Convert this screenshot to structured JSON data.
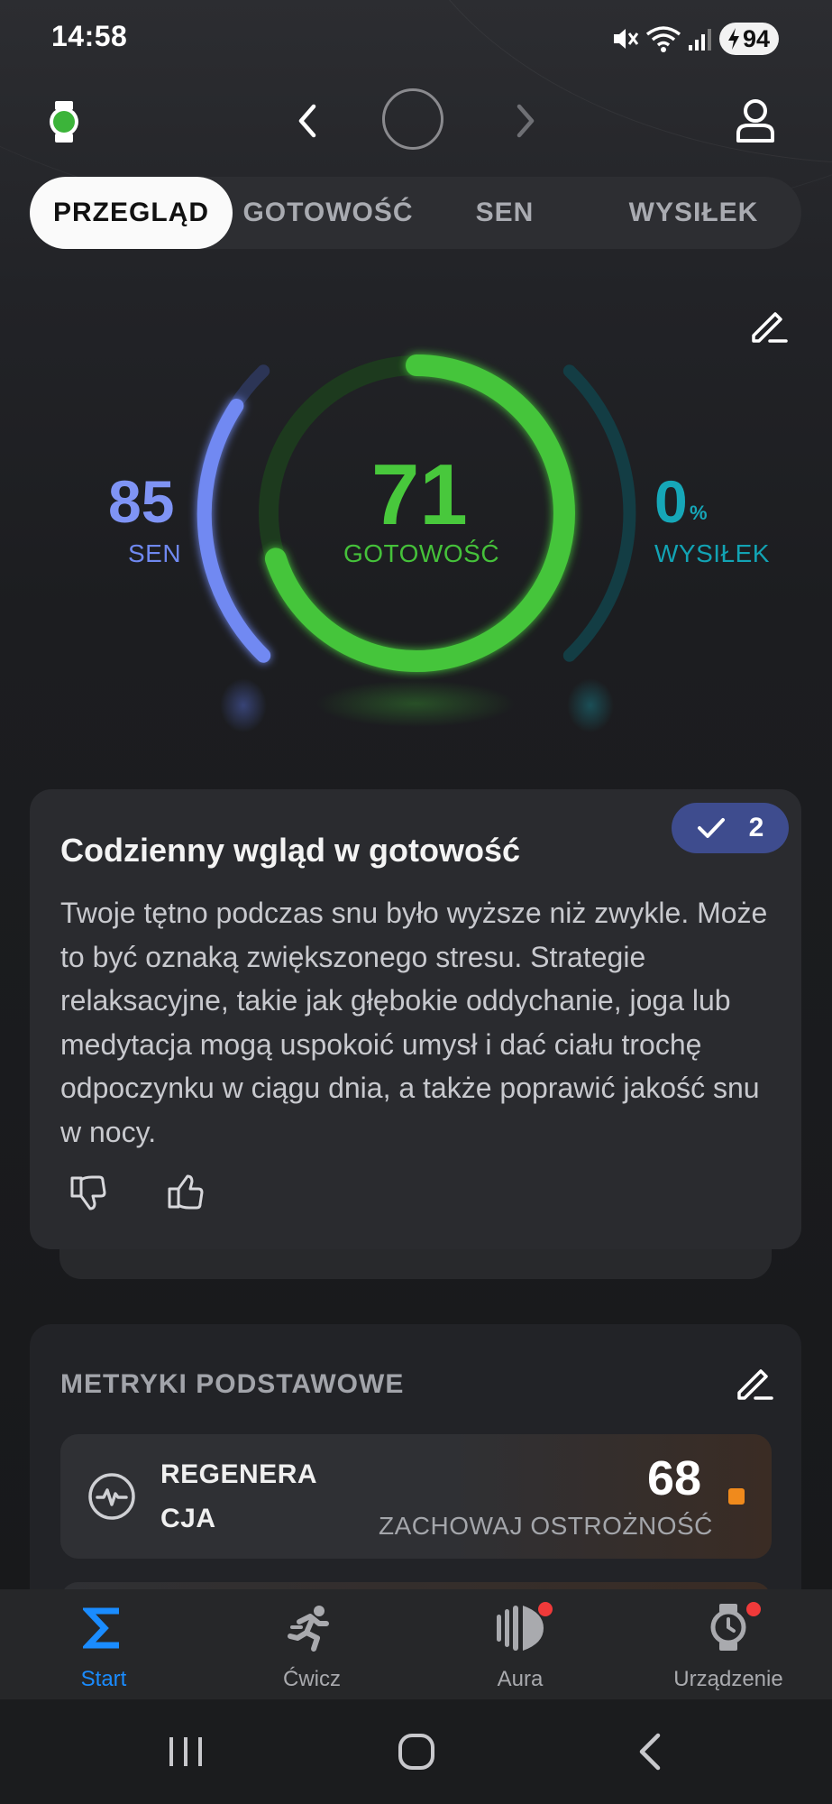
{
  "status_bar": {
    "time": "14:58",
    "battery": "94"
  },
  "tabs": [
    {
      "label": "PRZEGLĄD",
      "active": true
    },
    {
      "label": "GOTOWOŚĆ",
      "active": false
    },
    {
      "label": "SEN",
      "active": false
    },
    {
      "label": "WYSIŁEK",
      "active": false
    }
  ],
  "gauge": {
    "sleep": {
      "value": "85",
      "label": "SEN",
      "color": "#7f94f5"
    },
    "readiness": {
      "value": "71",
      "label": "GOTOWOŚĆ",
      "color": "#48c83c"
    },
    "effort": {
      "value": "0",
      "unit": "%",
      "label": "WYSIŁEK",
      "color": "#16a7b8"
    }
  },
  "insight": {
    "title": "Codzienny wgląd w gotowość",
    "badge_count": "2",
    "body": "Twoje tętno podczas snu było wyższe niż zwykle. Może to być oznaką zwiększonego stresu. Strategie relaksacyjne, takie jak głębokie oddychanie, joga lub medytacja mogą uspokoić umysł i dać ciału trochę odpoczynku w ciągu dnia, a także poprawić jakość snu w nocy."
  },
  "metrics": {
    "title": "METRYKI PODSTAWOWE",
    "items": [
      {
        "label": "REGENERACJA",
        "value": "68",
        "status": "ZACHOWAJ OSTROŻNOŚĆ",
        "status_color": "#f08a1c"
      }
    ]
  },
  "bottom_nav": [
    {
      "label": "Start",
      "icon": "sigma-icon",
      "active": true,
      "notification": false
    },
    {
      "label": "Ćwicz",
      "icon": "running-icon",
      "active": false,
      "notification": false
    },
    {
      "label": "Aura",
      "icon": "aura-icon",
      "active": false,
      "notification": true
    },
    {
      "label": "Urządzenie",
      "icon": "watch-icon",
      "active": false,
      "notification": true
    }
  ],
  "colors": {
    "accent": "#1a8cff",
    "badge": "#3e4c8e",
    "notification": "#f03a3a"
  }
}
